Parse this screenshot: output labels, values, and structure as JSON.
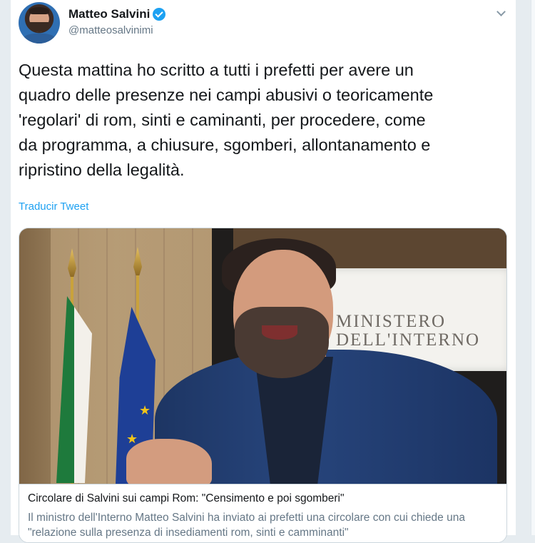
{
  "tweet": {
    "author_name": "Matteo Salvini",
    "handle": "@matteosalvinimi",
    "text": "Questa mattina ho scritto a tutti i prefetti per avere un\nquadro delle presenze nei campi abusivi o teoricamente\n'regolari' di rom, sinti e caminanti, per procedere, come\nda programma, a chiusure, sgomberi, allontanamento e\nripristino della legalità.",
    "translate_link": "Traducir Tweet"
  },
  "card": {
    "image_text": [
      "MINISTERO",
      "DELL'INTERNO"
    ],
    "title": "Circolare di Salvini sui campi Rom: \"Censimento e poi sgomberi\"",
    "description": "Il ministro dell'Interno Matteo Salvini ha inviato ai prefetti una circolare con cui chiede una \"relazione sulla presenza di insediamenti rom, sinti e camminanti\""
  },
  "icons": [
    "verified-badge-icon",
    "chevron-down-icon"
  ],
  "colors": {
    "accent": "#1da1f2",
    "text": "#14171a",
    "secondary": "#657786",
    "border": "#ccd6dd"
  }
}
